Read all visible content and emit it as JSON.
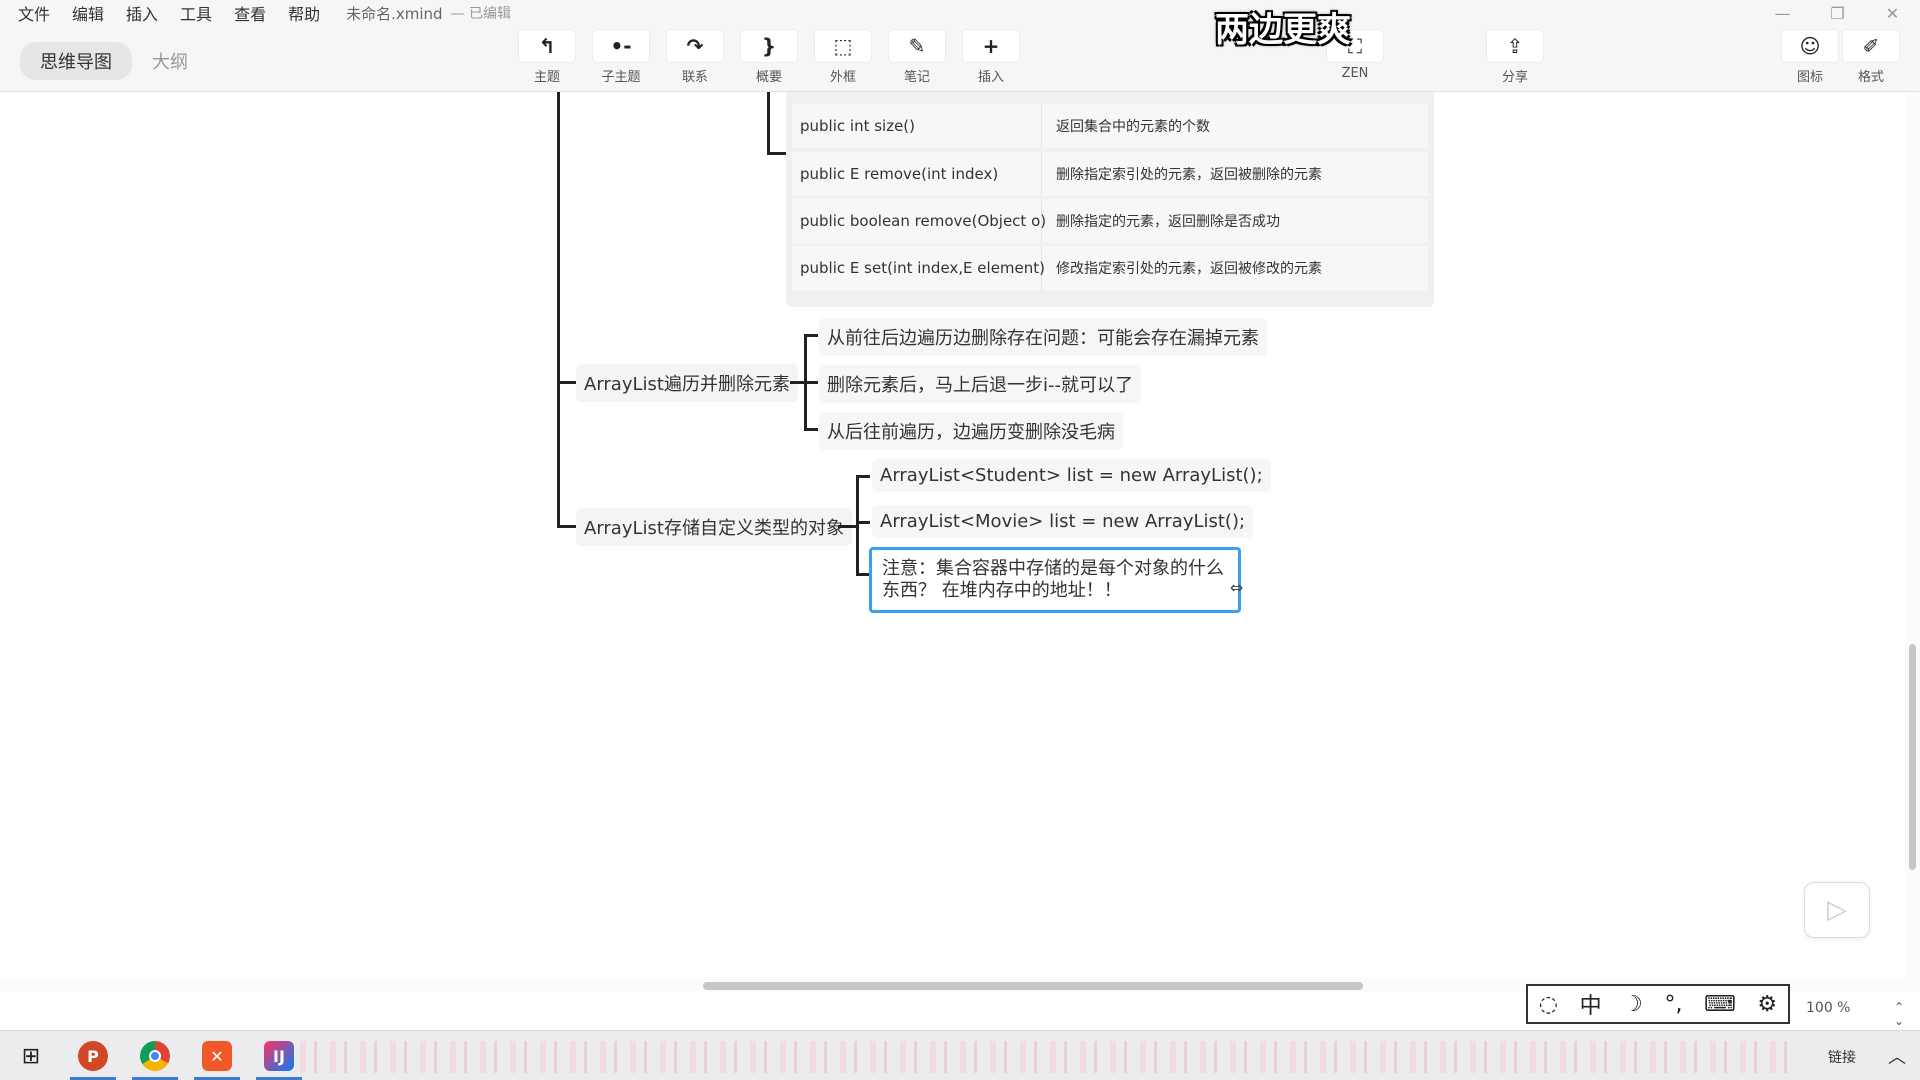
{
  "menu": {
    "items": [
      "文件",
      "编辑",
      "插入",
      "工具",
      "查看",
      "帮助"
    ],
    "doc_title": "未命名.xmind",
    "doc_status": "— 已编辑"
  },
  "view_tabs": {
    "mindmap": "思维导图",
    "outline": "大纲"
  },
  "toolbar": {
    "topic": "主题",
    "subtopic": "子主题",
    "relation": "联系",
    "summary": "概要",
    "boundary": "外框",
    "note": "笔记",
    "insert": "插入",
    "zen": "ZEN",
    "share": "分享",
    "icon": "图标",
    "format": "格式"
  },
  "subtitle": "两边更爽",
  "table_rows": [
    {
      "method": "public int size()",
      "desc": "返回集合中的元素的个数"
    },
    {
      "method": "public E remove(int index)",
      "desc": "删除指定索引处的元素，返回被删除的元素"
    },
    {
      "method": "public boolean remove(Object o)",
      "desc": "删除指定的元素，返回删除是否成功"
    },
    {
      "method": "public E set(int index,E element)",
      "desc": "修改指定索引处的元素，返回被修改的元素"
    }
  ],
  "topics": {
    "traverse_delete": "ArrayList遍历并删除元素",
    "custom_type": "ArrayList存储自定义类型的对象"
  },
  "traverse_leaves": [
    "从前往后边遍历边删除存在问题：可能会存在漏掉元素",
    "删除元素后，马上后退一步i--就可以了",
    "从后往前遍历，边遍历变删除没毛病"
  ],
  "custom_leaves": [
    "ArrayList<Student> list = new ArrayList();",
    "ArrayList<Movie> list = new ArrayList();",
    "注意：集合容器中存储的是每个对象的什么东西？ 在堆内存中的地址！！"
  ],
  "statusbar": {
    "zoom": "100 %"
  },
  "taskbar": {
    "tray_label": "链接"
  }
}
